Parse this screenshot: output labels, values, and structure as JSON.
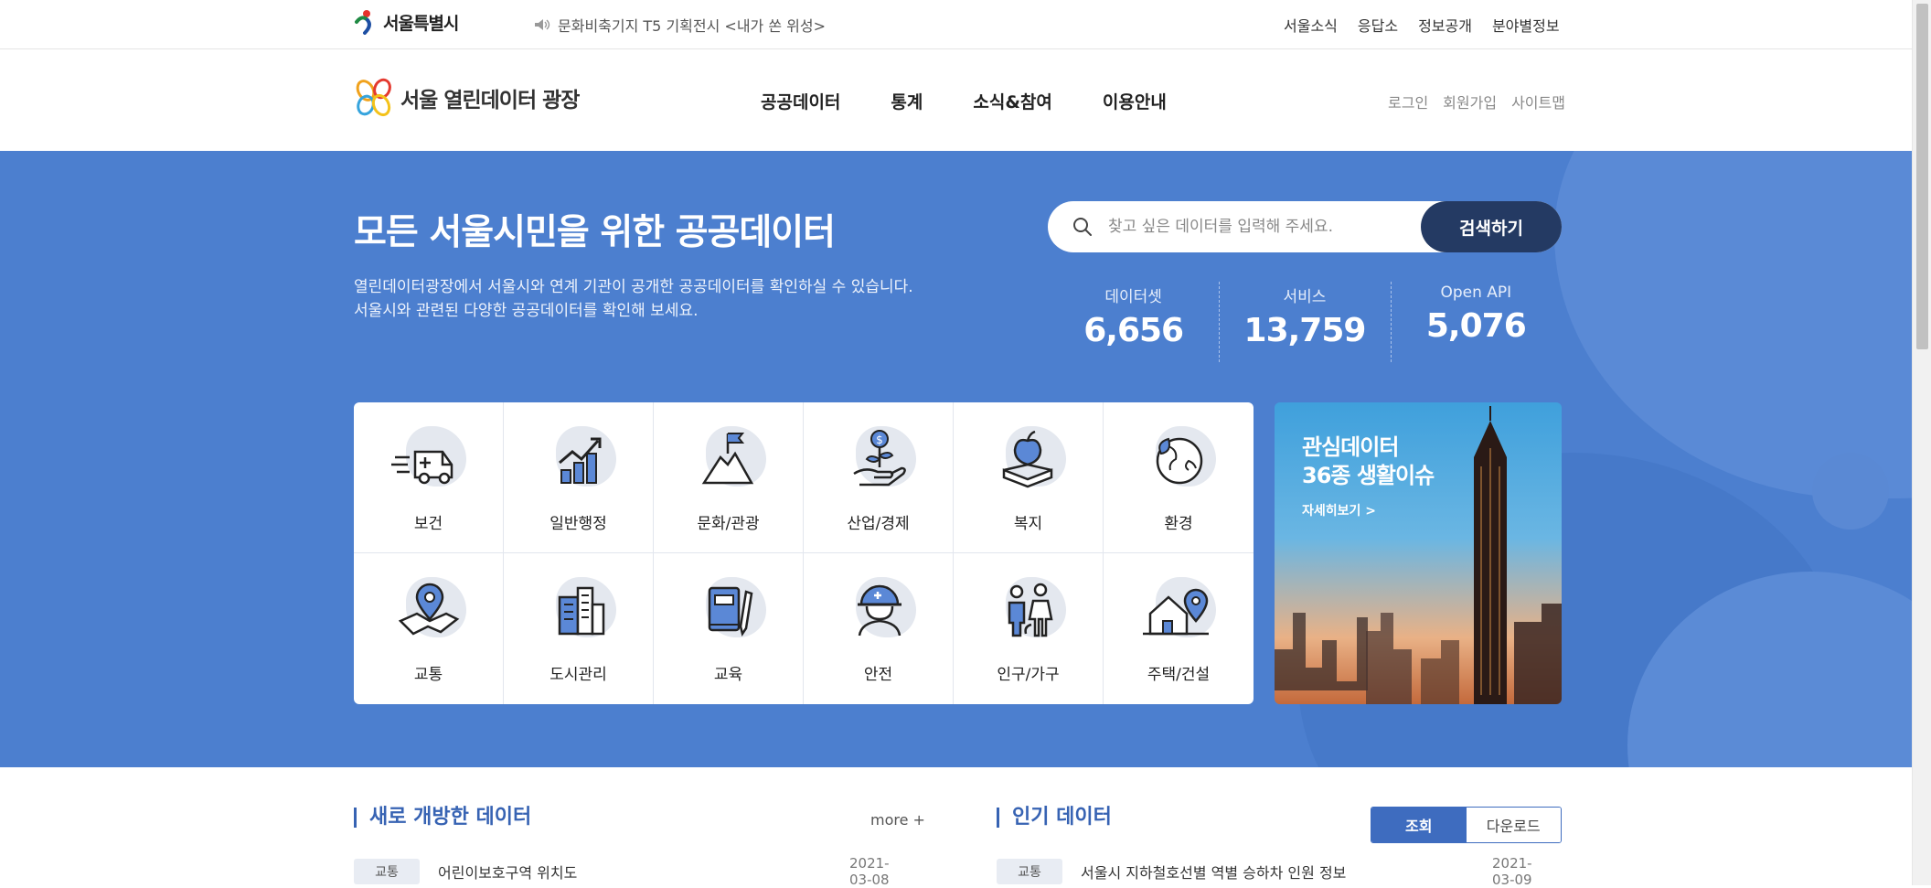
{
  "utility": {
    "seoul_logo": "서울특별시",
    "notice": "문화비축기지 T5 기획전시 <내가 쏜 위성>",
    "links": [
      "서울소식",
      "응답소",
      "정보공개",
      "분야별정보"
    ]
  },
  "header": {
    "logo_text": "서울 열린데이터 광장",
    "menu": [
      "공공데이터",
      "통계",
      "소식&참여",
      "이용안내"
    ],
    "member_links": [
      "로그인",
      "회원가입",
      "사이트맵"
    ]
  },
  "hero": {
    "title": "모든 서울시민을 위한 공공데이터",
    "desc_line1": "열린데이터광장에서 서울시와 연계 기관이 공개한 공공데이터를 확인하실 수 있습니다.",
    "desc_line2": "서울시와 관련된 다양한 공공데이터를 확인해 보세요.",
    "search": {
      "placeholder": "찾고 싶은 데이터를 입력해 주세요.",
      "button": "검색하기"
    },
    "stats": [
      {
        "label": "데이터셋",
        "value": "6,656"
      },
      {
        "label": "서비스",
        "value": "13,759"
      },
      {
        "label": "Open API",
        "value": "5,076"
      }
    ]
  },
  "categories": [
    {
      "label": "보건",
      "icon": "ambulance-icon"
    },
    {
      "label": "일반행정",
      "icon": "chart-growth-icon"
    },
    {
      "label": "문화/관광",
      "icon": "mountain-flag-icon"
    },
    {
      "label": "산업/경제",
      "icon": "money-plant-icon"
    },
    {
      "label": "복지",
      "icon": "apple-book-icon"
    },
    {
      "label": "환경",
      "icon": "earth-leaf-icon"
    },
    {
      "label": "교통",
      "icon": "map-pin-icon"
    },
    {
      "label": "도시관리",
      "icon": "buildings-icon"
    },
    {
      "label": "교육",
      "icon": "notebook-pen-icon"
    },
    {
      "label": "안전",
      "icon": "worker-helmet-icon"
    },
    {
      "label": "인구/가구",
      "icon": "family-icon"
    },
    {
      "label": "주택/건설",
      "icon": "house-pin-icon"
    }
  ],
  "banner": {
    "line1": "관심데이터",
    "line2": "36종 생활이슈",
    "more": "자세히보기 >"
  },
  "new_data": {
    "title": "새로 개방한 데이터",
    "more": "more +",
    "items": [
      {
        "badge": "교통",
        "title": "어린이보호구역 위치도",
        "date": "2021-03-08"
      }
    ]
  },
  "popular_data": {
    "title": "인기 데이터",
    "tabs": [
      "조회",
      "다운로드"
    ],
    "items": [
      {
        "badge": "교통",
        "title": "서울시 지하철호선별 역별 승하차 인원 정보",
        "date": "2021-03-09"
      }
    ]
  },
  "colors": {
    "hero_bg": "#4c7fcf",
    "search_button": "#243a63",
    "accent": "#3763b3"
  }
}
